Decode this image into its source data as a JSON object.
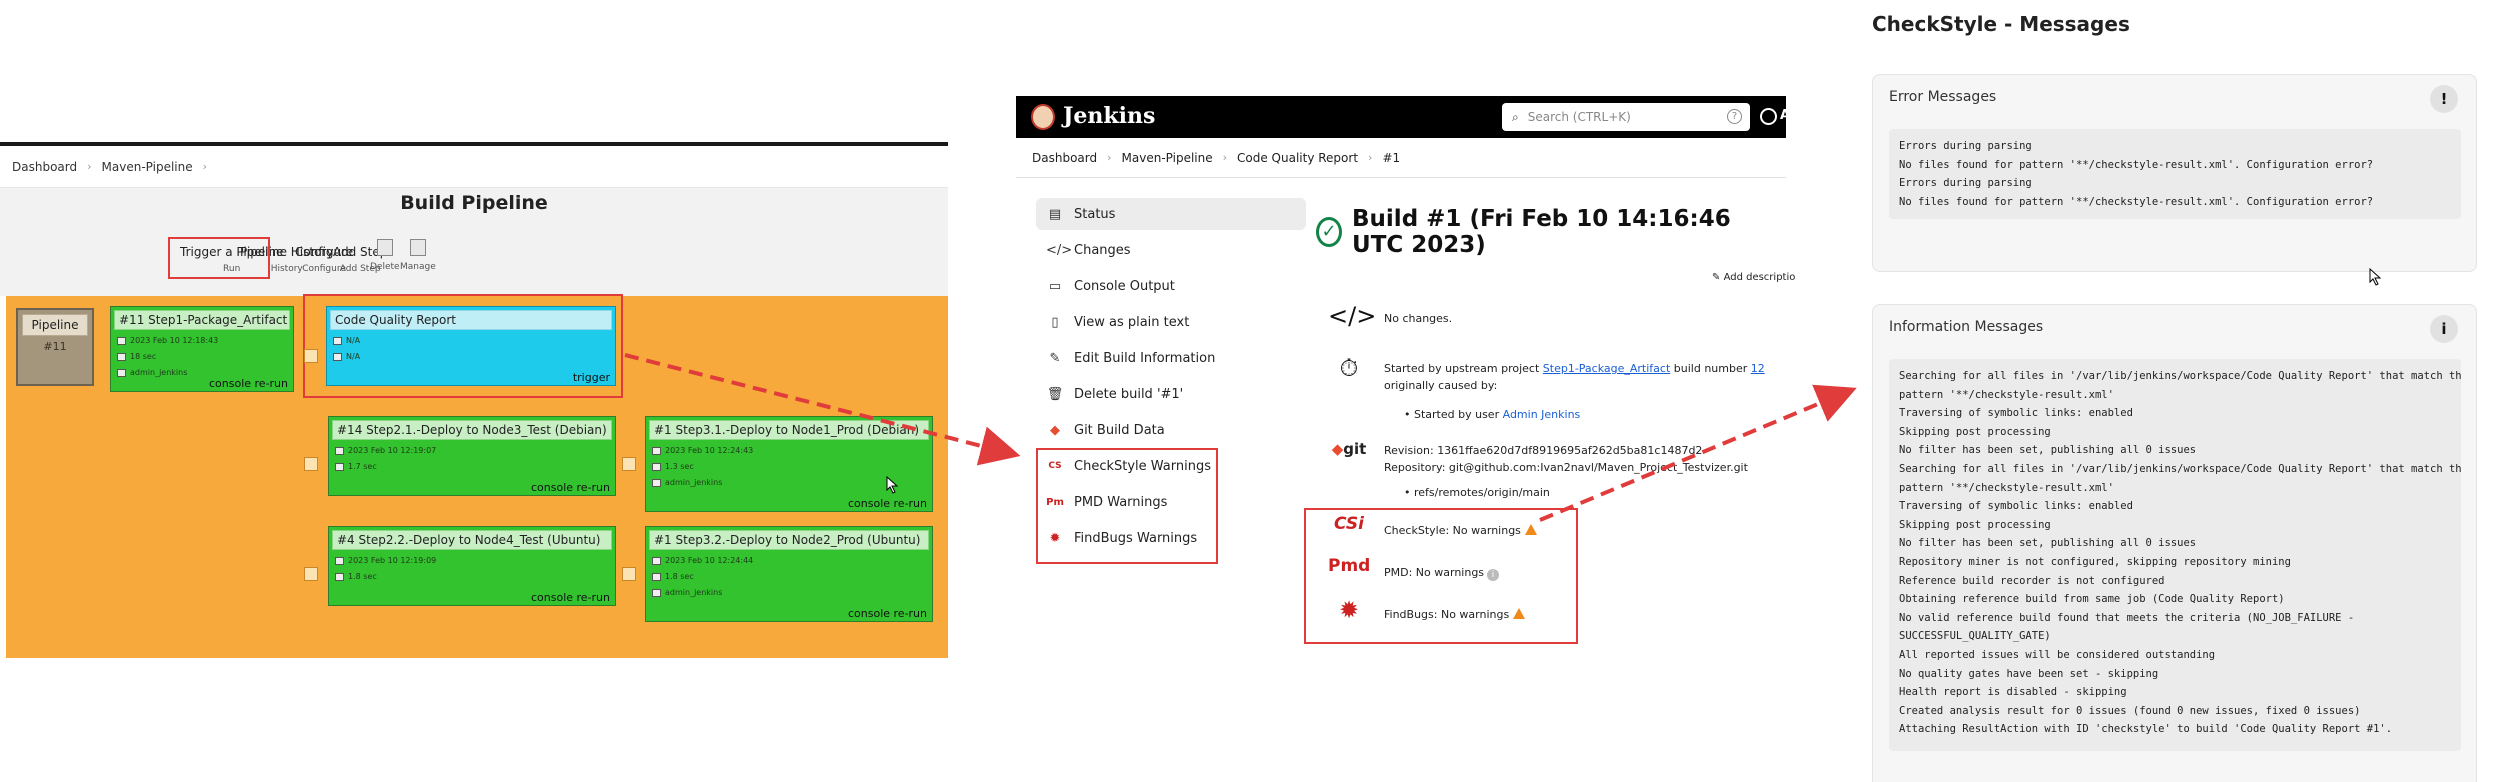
{
  "pipeline": {
    "breadcrumb": [
      "Dashboard",
      "Maven-Pipeline"
    ],
    "title": "Build Pipeline",
    "menu": [
      {
        "label": "Trigger a Pipeline",
        "sub": "Run"
      },
      {
        "label": "Pipeline History",
        "sub": "History"
      },
      {
        "label": "Configure",
        "sub": "Configure"
      },
      {
        "label": "Add Step",
        "sub": "Add Step"
      },
      {
        "label": "",
        "sub": "Delete"
      },
      {
        "label": "",
        "sub": "Manage"
      }
    ],
    "pipeline_box": {
      "label": "Pipeline",
      "num": "#11"
    },
    "jobs": [
      {
        "title": "#11 Step1-Package_Artifact",
        "date": "2023 Feb 10 12:18:43",
        "duration": "18 sec",
        "user": "admin_jenkins",
        "footer": "console re-run",
        "status": "success"
      },
      {
        "title": "Code Quality Report",
        "date": "N/A",
        "duration": "N/A",
        "user": "",
        "footer": "trigger",
        "status": "pending"
      },
      {
        "title": "#14 Step2.1.-Deploy to Node3_Test (Debian)",
        "date": "2023 Feb 10 12:19:07",
        "duration": "1.7 sec",
        "user": "",
        "footer": "console re-run",
        "status": "success"
      },
      {
        "title": "#1 Step3.1.-Deploy to Node1_Prod (Debian)",
        "date": "2023 Feb 10 12:24:43",
        "duration": "1.3 sec",
        "user": "admin_jenkins",
        "footer": "console re-run",
        "status": "success"
      },
      {
        "title": "#4 Step2.2.-Deploy to Node4_Test (Ubuntu)",
        "date": "2023 Feb 10 12:19:09",
        "duration": "1.8 sec",
        "user": "",
        "footer": "console re-run",
        "status": "success"
      },
      {
        "title": "#1 Step3.2.-Deploy to Node2_Prod (Ubuntu)",
        "date": "2023 Feb 10 12:24:44",
        "duration": "1.8 sec",
        "user": "admin_jenkins",
        "footer": "console re-run",
        "status": "success"
      }
    ]
  },
  "jenkins": {
    "brand": "Jenkins",
    "search_placeholder": "Search (CTRL+K)",
    "user_initial": "A",
    "breadcrumb": [
      "Dashboard",
      "Maven-Pipeline",
      "Code Quality Report",
      "#1"
    ],
    "sidebar": [
      {
        "label": "Status",
        "icon": "status-icon"
      },
      {
        "label": "Changes",
        "icon": "code-icon"
      },
      {
        "label": "Console Output",
        "icon": "terminal-icon"
      },
      {
        "label": "View as plain text",
        "icon": "document-icon"
      },
      {
        "label": "Edit Build Information",
        "icon": "edit-icon"
      },
      {
        "label": "Delete build '#1'",
        "icon": "trash-icon"
      },
      {
        "label": "Git Build Data",
        "icon": "git-icon"
      },
      {
        "label": "CheckStyle Warnings",
        "icon": "checkstyle-icon"
      },
      {
        "label": "PMD Warnings",
        "icon": "pmd-icon"
      },
      {
        "label": "FindBugs Warnings",
        "icon": "findbugs-icon"
      }
    ],
    "build_title": "Build #1 (Fri Feb 10 14:16:46 UTC 2023)",
    "add_description": "Add descriptio",
    "changes": "No changes.",
    "upstream": {
      "prefix": "Started by upstream project ",
      "project": "Step1-Package_Artifact",
      "middle": " build number ",
      "number": "12",
      "line2": "originally caused by:",
      "by_prefix": "Started by user ",
      "by_user": "Admin Jenkins"
    },
    "git": {
      "revision_label": "Revision:",
      "revision": "1361ffae620d7df8919695af262d5ba81c1487d2",
      "repository_label": "Repository:",
      "repository": "git@github.com:Ivan2navl/Maven_Project_Testvizer.git",
      "ref": "refs/remotes/origin/main"
    },
    "warnings": [
      {
        "label": "CheckStyle: No warnings",
        "icon": "warning-icon"
      },
      {
        "label": "PMD: No warnings",
        "icon": "info-icon"
      },
      {
        "label": "FindBugs: No warnings",
        "icon": "warning-icon"
      }
    ]
  },
  "checkstyle": {
    "title": "CheckStyle - Messages",
    "error_title": "Error Messages",
    "error_text": "Errors during parsing\nNo files found for pattern '**/checkstyle-result.xml'. Configuration error?\nErrors during parsing\nNo files found for pattern '**/checkstyle-result.xml'. Configuration error?",
    "info_title": "Information Messages",
    "info_text": "Searching for all files in '/var/lib/jenkins/workspace/Code Quality Report' that match the\npattern '**/checkstyle-result.xml'\nTraversing of symbolic links: enabled\nSkipping post processing\nNo filter has been set, publishing all 0 issues\nSearching for all files in '/var/lib/jenkins/workspace/Code Quality Report' that match the\npattern '**/checkstyle-result.xml'\nTraversing of symbolic links: enabled\nSkipping post processing\nNo filter has been set, publishing all 0 issues\nRepository miner is not configured, skipping repository mining\nReference build recorder is not configured\nObtaining reference build from same job (Code Quality Report)\nNo valid reference build found that meets the criteria (NO_JOB_FAILURE -\nSUCCESSFUL_QUALITY_GATE)\nAll reported issues will be considered outstanding\nNo quality gates have been set - skipping\nHealth report is disabled - skipping\nCreated analysis result for 0 issues (found 0 new issues, fixed 0 issues)\nAttaching ResultAction with ID 'checkstyle' to build 'Code Quality Report #1'.",
    "error_badge": "!",
    "info_badge": "i"
  },
  "colors": {
    "success": "#33c32e",
    "pending": "#1fcbea",
    "background": "#f8a93b",
    "highlight": "#e03c3c"
  }
}
